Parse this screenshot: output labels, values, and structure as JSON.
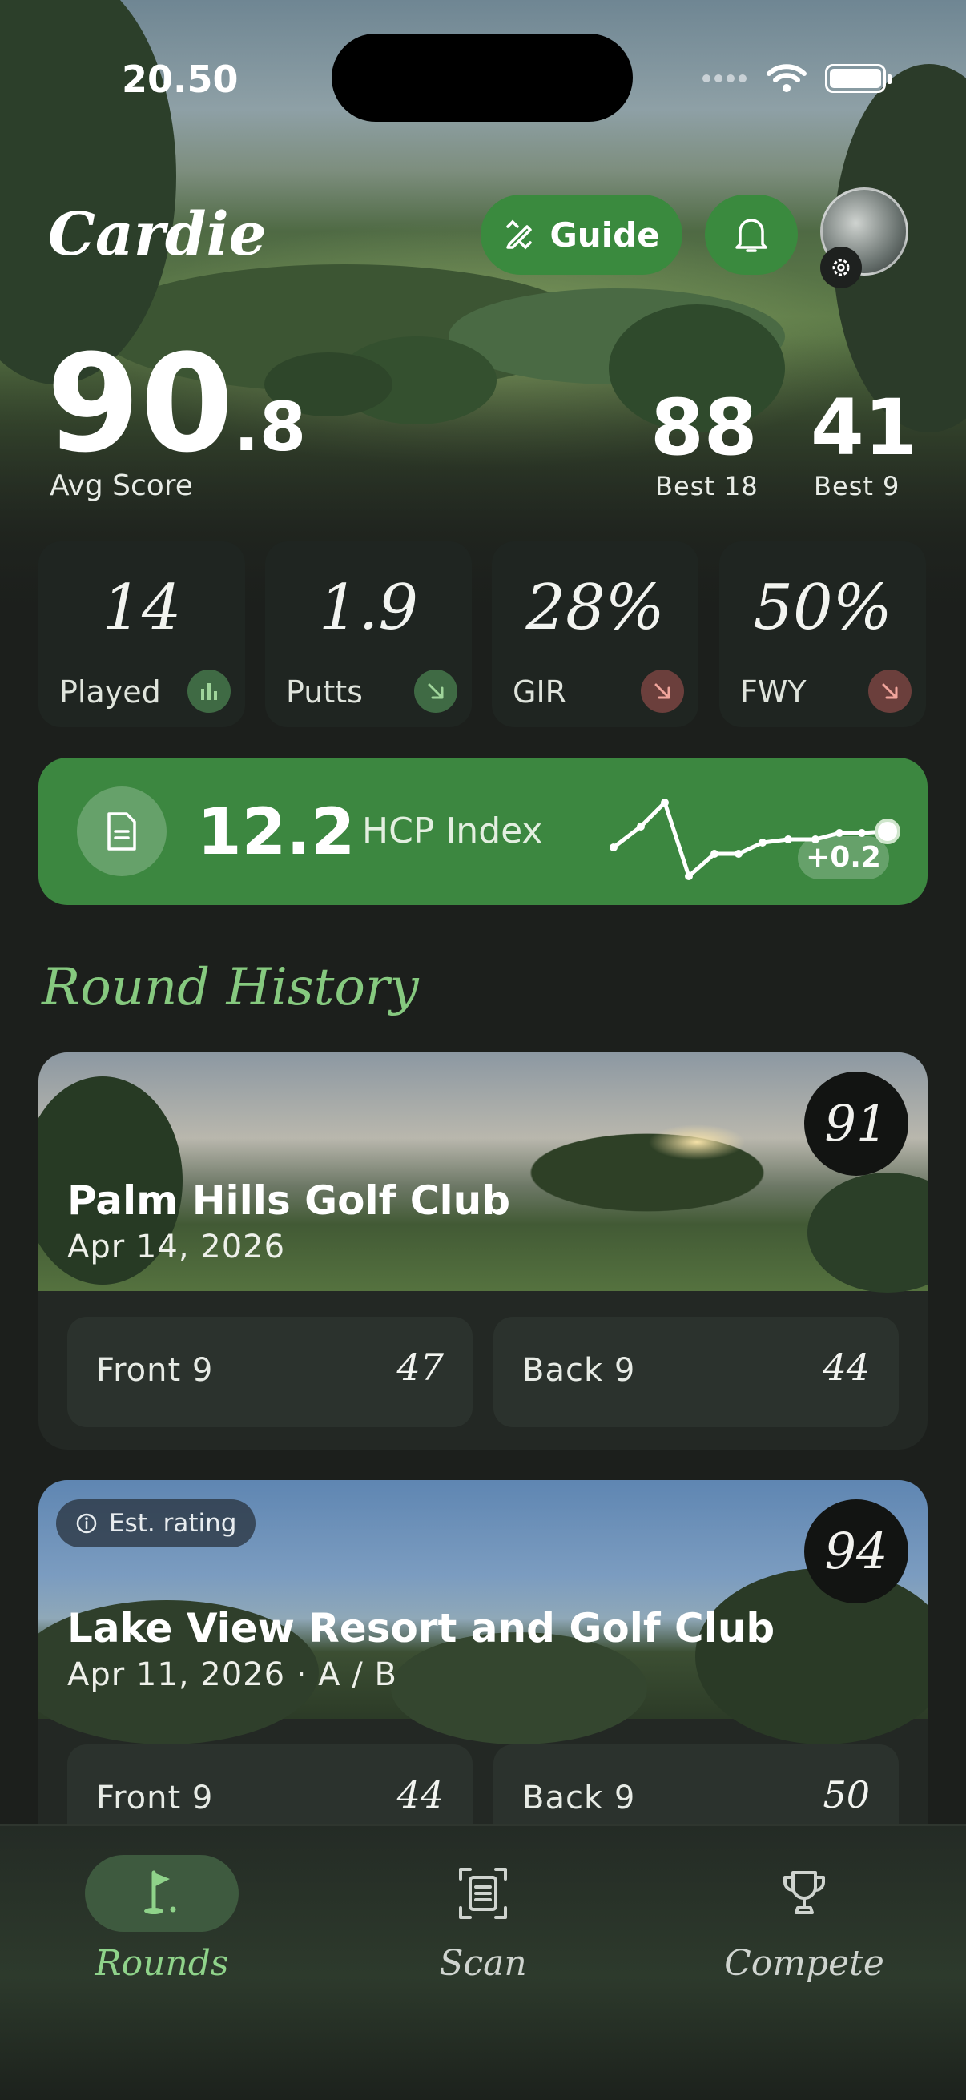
{
  "status_bar": {
    "time": "20.50"
  },
  "header": {
    "app_title": "Cardie",
    "guide_label": "Guide"
  },
  "scores": {
    "avg_int": "90",
    "avg_dec": ".8",
    "avg_label": "Avg Score",
    "best18_value": "88",
    "best18_label": "Best 18",
    "best9_value": "41",
    "best9_label": "Best 9"
  },
  "stats": [
    {
      "value": "14",
      "label": "Played",
      "icon": "bar-chart-icon",
      "trend_color": "#3f6a44"
    },
    {
      "value": "1.9",
      "label": "Putts",
      "icon": "arrow-down-right-icon",
      "trend_color": "#3f6a44"
    },
    {
      "value": "28%",
      "label": "GIR",
      "icon": "arrow-down-right-icon",
      "trend_color": "#6b3f3c"
    },
    {
      "value": "50%",
      "label": "FWY",
      "icon": "arrow-down-right-icon",
      "trend_color": "#6b3f3c"
    }
  ],
  "hcp": {
    "value": "12.2",
    "label": "HCP Index",
    "delta": "+0.2"
  },
  "history": {
    "title": "Round History",
    "rounds": [
      {
        "course": "Palm Hills Golf Club",
        "date": "Apr 14, 2026",
        "score": "91",
        "front_label": "Front 9",
        "front_value": "47",
        "back_label": "Back 9",
        "back_value": "44"
      },
      {
        "badge": "Est. rating",
        "course": "Lake View Resort and Golf Club",
        "date": "Apr 11, 2026  ·  A / B",
        "score": "94",
        "front_label": "Front 9",
        "front_value": "44",
        "back_label": "Back 9",
        "back_value": "50"
      }
    ]
  },
  "tabs": [
    {
      "label": "Rounds",
      "icon": "golf-flag-icon",
      "active": true
    },
    {
      "label": "Scan",
      "icon": "scan-document-icon",
      "active": false
    },
    {
      "label": "Compete",
      "icon": "trophy-icon",
      "active": false
    }
  ],
  "colors": {
    "accent": "#3a8a3e",
    "accent_text": "#86c97f",
    "background": "#1c1f1c"
  }
}
